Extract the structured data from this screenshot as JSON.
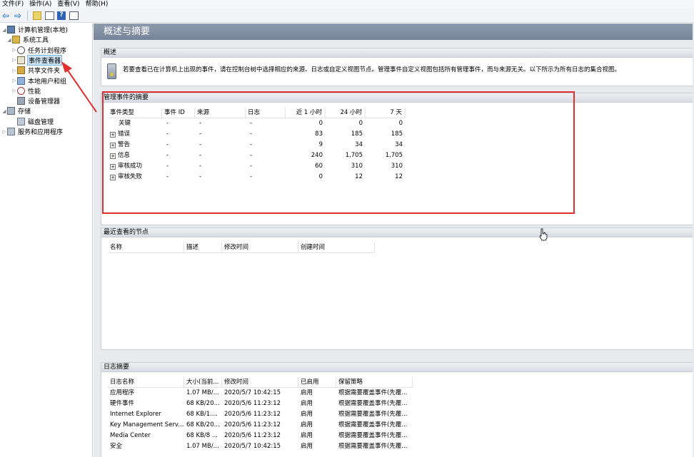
{
  "menu": [
    "文件(F)",
    "操作(A)",
    "查看(V)",
    "帮助(H)"
  ],
  "tree": [
    {
      "label": "计算机管理(本地)",
      "level": 0,
      "expander": "◢",
      "icon": "computer-icon"
    },
    {
      "label": "系统工具",
      "level": 1,
      "expander": "◢",
      "icon": "tools-icon"
    },
    {
      "label": "任务计划程序",
      "level": 2,
      "expander": "▷",
      "icon": "clock-icon"
    },
    {
      "label": "事件查看器",
      "level": 2,
      "expander": "▷",
      "icon": "event-viewer-icon",
      "selected": true
    },
    {
      "label": "共享文件夹",
      "level": 2,
      "expander": "▷",
      "icon": "shared-folder-icon"
    },
    {
      "label": "本地用户和组",
      "level": 2,
      "expander": "▷",
      "icon": "users-icon"
    },
    {
      "label": "性能",
      "level": 2,
      "expander": "▷",
      "icon": "performance-icon"
    },
    {
      "label": "设备管理器",
      "level": 2,
      "expander": "",
      "icon": "device-manager-icon"
    },
    {
      "label": "存储",
      "level": 0,
      "expander": "◢",
      "icon": "storage-icon"
    },
    {
      "label": "磁盘管理",
      "level": 2,
      "expander": "",
      "icon": "disk-icon"
    },
    {
      "label": "服务和应用程序",
      "level": 0,
      "expander": "▷",
      "icon": "services-icon"
    }
  ],
  "header": {
    "title": "概述与摘要"
  },
  "overview": {
    "section_title": "概述",
    "text": "若要查看已在计算机上出现的事件，请在控制台树中选择相应的来源、日志或自定义视图节点。管理事件自定义视图包括所有管理事件，而与来源无关。以下所示为所有日志的集合视图。"
  },
  "summary": {
    "section_title": "管理事件的摘要",
    "columns": [
      "事件类型",
      "事件 ID",
      "来源",
      "日志",
      "近 1 小时",
      "24 小时",
      "7 天"
    ],
    "rows": [
      {
        "type": "关键",
        "expandable": false,
        "id": "-",
        "source": "-",
        "log": "-",
        "hour": "0",
        "day": "0",
        "week": "0"
      },
      {
        "type": "错误",
        "expandable": true,
        "id": "-",
        "source": "-",
        "log": "-",
        "hour": "83",
        "day": "185",
        "week": "185"
      },
      {
        "type": "警告",
        "expandable": true,
        "id": "-",
        "source": "-",
        "log": "-",
        "hour": "9",
        "day": "34",
        "week": "34"
      },
      {
        "type": "信息",
        "expandable": true,
        "id": "-",
        "source": "-",
        "log": "-",
        "hour": "240",
        "day": "1,705",
        "week": "1,705"
      },
      {
        "type": "审核成功",
        "expandable": true,
        "id": "-",
        "source": "-",
        "log": "-",
        "hour": "60",
        "day": "310",
        "week": "310"
      },
      {
        "type": "审核失败",
        "expandable": true,
        "id": "-",
        "source": "-",
        "log": "-",
        "hour": "0",
        "day": "12",
        "week": "12"
      }
    ]
  },
  "recent": {
    "section_title": "最近查看的节点",
    "columns": [
      "名称",
      "描述",
      "修改时间",
      "创建时间"
    ]
  },
  "logs": {
    "section_title": "日志摘要",
    "columns": [
      "日志名称",
      "大小(当前...",
      "修改时间",
      "已启用",
      "保留策略"
    ],
    "rows": [
      {
        "name": "应用程序",
        "size": "1.07 MB/...",
        "modified": "2020/5/7 10:42:15",
        "enabled": "启用",
        "policy": "根据需要覆盖事件(先覆..."
      },
      {
        "name": "硬件事件",
        "size": "68 KB/20...",
        "modified": "2020/5/6 11:23:12",
        "enabled": "启用",
        "policy": "根据需要覆盖事件(先覆..."
      },
      {
        "name": "Internet Explorer",
        "size": "68 KB/1....",
        "modified": "2020/5/6 11:23:12",
        "enabled": "启用",
        "policy": "根据需要覆盖事件(先覆..."
      },
      {
        "name": "Key Management Serv...",
        "size": "68 KB/20...",
        "modified": "2020/5/6 11:23:12",
        "enabled": "启用",
        "policy": "根据需要覆盖事件(先覆..."
      },
      {
        "name": "Media Center",
        "size": "68 KB/8 ...",
        "modified": "2020/5/6 11:23:12",
        "enabled": "启用",
        "policy": "根据需要覆盖事件(先覆..."
      },
      {
        "name": "安全",
        "size": "1.07 MB/...",
        "modified": "2020/5/7 10:42:15",
        "enabled": "启用",
        "policy": "根据需要覆盖事件(先覆..."
      }
    ]
  },
  "annotation_color": "#e03030"
}
